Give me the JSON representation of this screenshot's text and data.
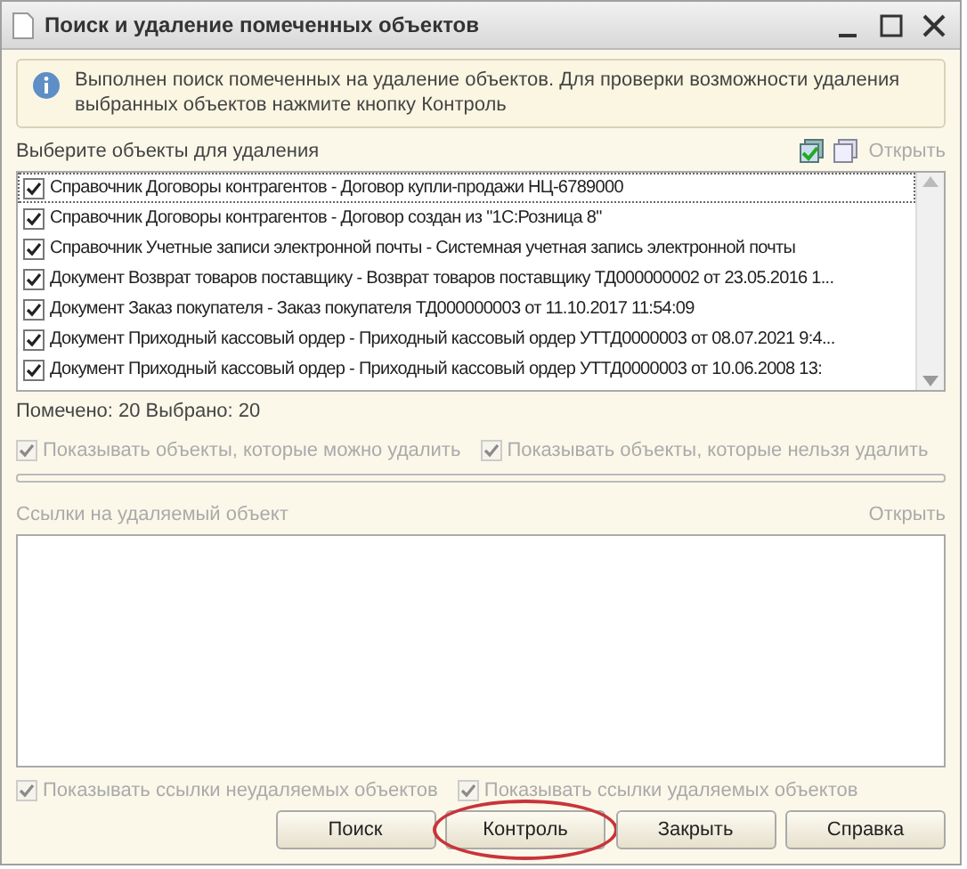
{
  "window": {
    "title": "Поиск и удаление помеченных объектов"
  },
  "info": "Выполнен поиск помеченных на удаление объектов. Для проверки возможности удаления выбранных объектов нажмите кнопку Контроль",
  "objects": {
    "label": "Выберите объекты для удаления",
    "open_link": "Открыть",
    "items": [
      {
        "text": "Справочник Договоры контрагентов - Договор купли-продажи НЦ-6789000",
        "checked": true,
        "selected": true
      },
      {
        "text": "Справочник Договоры контрагентов - Договор создан из \"1С:Розница 8\"",
        "checked": true,
        "selected": false
      },
      {
        "text": "Справочник Учетные записи электронной почты - Системная учетная запись электронной почты",
        "checked": true,
        "selected": false
      },
      {
        "text": "Документ Возврат товаров поставщику - Возврат товаров поставщику ТД000000002 от 23.05.2016 1...",
        "checked": true,
        "selected": false
      },
      {
        "text": "Документ Заказ покупателя - Заказ покупателя ТД000000003 от 11.10.2017 11:54:09",
        "checked": true,
        "selected": false
      },
      {
        "text": "Документ Приходный кассовый ордер - Приходный кассовый ордер УТТД0000003 от 08.07.2021 9:4...",
        "checked": true,
        "selected": false
      },
      {
        "text": "Документ Приходный кассовый ордер - Приходный кассовый ордер УТТД0000003 от 10.06.2008 13:",
        "checked": true,
        "selected": false
      }
    ]
  },
  "counts": "Помечено: 20  Выбрано: 20",
  "filters": [
    {
      "label": "Показывать объекты, которые можно удалить",
      "checked": true,
      "disabled": true
    },
    {
      "label": "Показывать объекты, которые нельзя удалить",
      "checked": true,
      "disabled": true
    }
  ],
  "links": {
    "label": "Ссылки на удаляемый объект",
    "open_link": "Открыть"
  },
  "link_filters": [
    {
      "label": "Показывать ссылки неудаляемых объектов",
      "checked": true,
      "disabled": true
    },
    {
      "label": "Показывать ссылки удаляемых объектов",
      "checked": true,
      "disabled": true
    }
  ],
  "buttons": [
    {
      "label": "Поиск",
      "circled": false
    },
    {
      "label": "Контроль",
      "circled": true
    },
    {
      "label": "Закрыть",
      "circled": false
    },
    {
      "label": "Справка",
      "circled": false
    }
  ]
}
